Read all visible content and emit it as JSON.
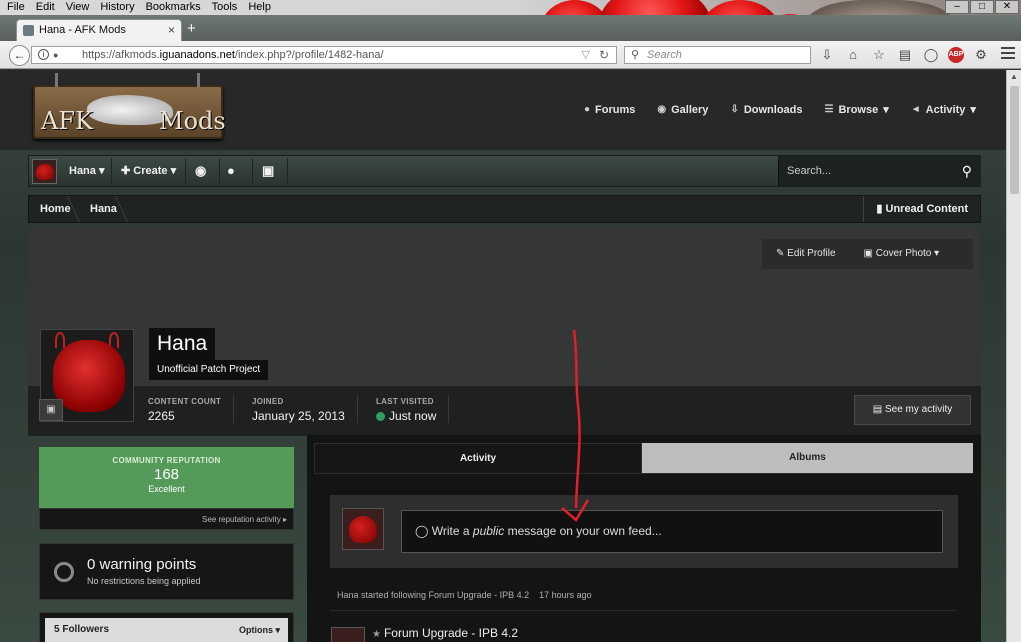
{
  "browser": {
    "menu": [
      "File",
      "Edit",
      "View",
      "History",
      "Bookmarks",
      "Tools",
      "Help"
    ],
    "tab_title": "Hana - AFK Mods",
    "new_tab": "+",
    "url_prefix": "https://afkmods.",
    "url_domain": "iguanadons.net",
    "url_path": "/index.php?/profile/1482-hana/",
    "search_placeholder": "Search",
    "adblock_label": "ABP"
  },
  "site": {
    "logo_left": "AFK",
    "logo_right": "Mods",
    "nav": [
      {
        "label": "Forums",
        "icon": "comments-icon"
      },
      {
        "label": "Gallery",
        "icon": "camera-icon"
      },
      {
        "label": "Downloads",
        "icon": "download-icon"
      },
      {
        "label": "Browse",
        "icon": "list-icon"
      },
      {
        "label": "Activity",
        "icon": "megaphone-icon"
      }
    ]
  },
  "userbar": {
    "username": "Hana",
    "create": "Create",
    "search_placeholder": "Search..."
  },
  "breadcrumb": {
    "items": [
      "Home",
      "Hana"
    ],
    "unread": "Unread Content"
  },
  "profile": {
    "edit_profile": "Edit Profile",
    "cover_photo": "Cover Photo",
    "name": "Hana",
    "group": "Unofficial Patch Project",
    "stats": [
      {
        "label": "CONTENT COUNT",
        "value": "2265"
      },
      {
        "label": "JOINED",
        "value": "January 25, 2013"
      },
      {
        "label": "LAST VISITED",
        "value": "Just now"
      }
    ],
    "see_activity": "See my activity"
  },
  "sidebar": {
    "rep_title": "COMMUNITY REPUTATION",
    "rep_value": "168",
    "rep_label": "Excellent",
    "rep_link": "See reputation activity",
    "warn_title": "0 warning points",
    "warn_sub": "No restrictions being applied",
    "followers": "5 Followers",
    "followers_options": "Options"
  },
  "main": {
    "tabs": [
      "Activity",
      "Albums"
    ],
    "composer_prefix": "Write a ",
    "composer_em": "public",
    "composer_suffix": " message on your own feed...",
    "feed_text": "Hana started following Forum Upgrade - IPB 4.2",
    "feed_time": "17 hours ago",
    "feed_title": "Forum Upgrade - IPB 4.2"
  },
  "colors": {
    "reputation_green": "#549a58",
    "online_dot": "#2e9e5b",
    "annotation_red": "#e0202a"
  }
}
